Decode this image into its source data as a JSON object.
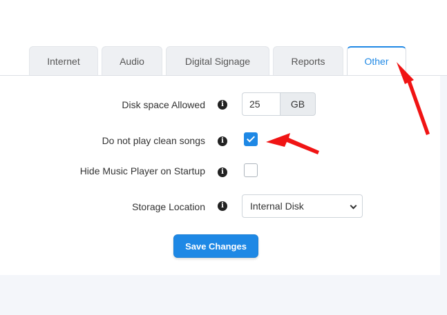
{
  "tabs": [
    {
      "label": "Internet",
      "active": false
    },
    {
      "label": "Audio",
      "active": false
    },
    {
      "label": "Digital Signage",
      "active": false
    },
    {
      "label": "Reports",
      "active": false
    },
    {
      "label": "Other",
      "active": true
    }
  ],
  "settings": {
    "disk_space": {
      "label": "Disk space Allowed",
      "value": "25",
      "unit": "GB"
    },
    "no_clean_songs": {
      "label": "Do not play clean songs",
      "checked": true
    },
    "hide_player": {
      "label": "Hide Music Player on Startup",
      "checked": false
    },
    "storage_location": {
      "label": "Storage Location",
      "selected": "Internal Disk"
    }
  },
  "info_icon_glyph": "i",
  "save_button": {
    "label": "Save Changes"
  },
  "colors": {
    "accent": "#1e88e5",
    "annotation_arrow": "#f01414"
  }
}
